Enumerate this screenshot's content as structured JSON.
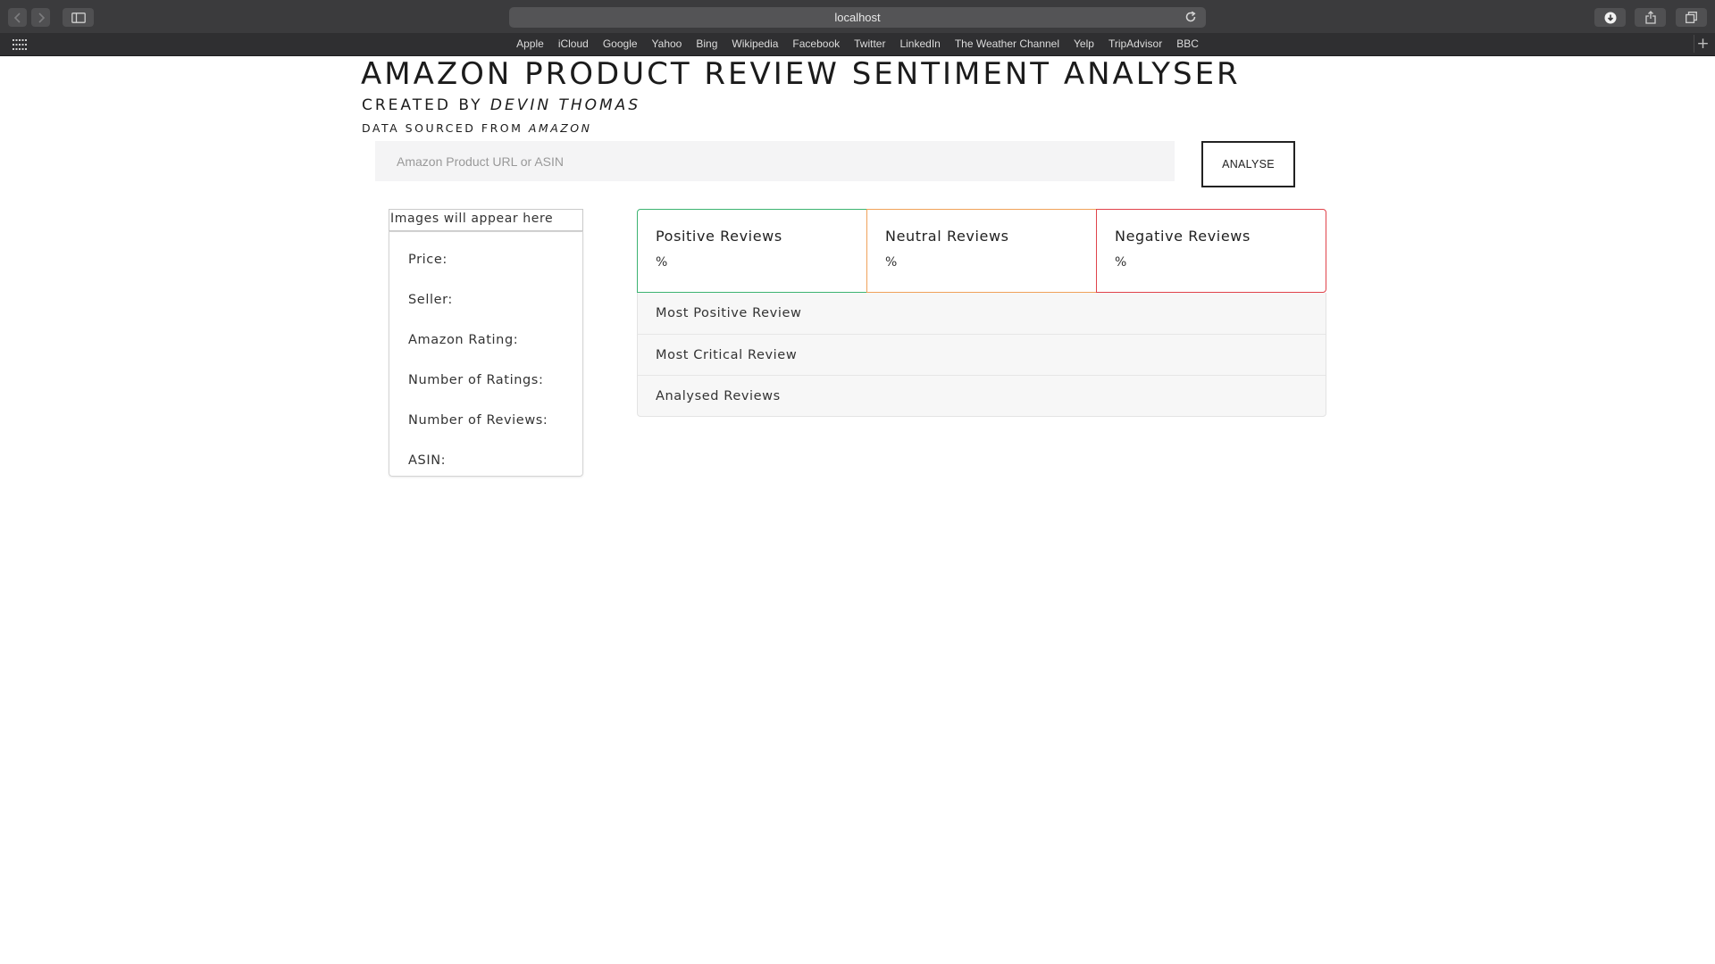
{
  "browser": {
    "url": "localhost",
    "favorites": [
      "Apple",
      "iCloud",
      "Google",
      "Yahoo",
      "Bing",
      "Wikipedia",
      "Facebook",
      "Twitter",
      "LinkedIn",
      "The Weather Channel",
      "Yelp",
      "TripAdvisor",
      "BBC"
    ]
  },
  "header": {
    "title": "AMAZON PRODUCT REVIEW SENTIMENT ANALYSER",
    "created_by_prefix": "CREATED BY ",
    "author": "DEVIN THOMAS",
    "source_prefix": "DATA SOURCED FROM ",
    "source": "AMAZON"
  },
  "search": {
    "placeholder": "Amazon Product URL or ASIN",
    "button_label": "ANALYSE"
  },
  "product": {
    "image_placeholder": "Images will appear here",
    "fields": [
      "Price:",
      "Seller:",
      "Amazon Rating:",
      "Number of Ratings:",
      "Number of Reviews:",
      "ASIN:"
    ]
  },
  "stats": {
    "positive": {
      "label": "Positive Reviews",
      "value": "%",
      "color": "#3cb371"
    },
    "neutral": {
      "label": "Neutral Reviews",
      "value": "%",
      "color": "#f0a25a"
    },
    "negative": {
      "label": "Negative Reviews",
      "value": "%",
      "color": "#e0434b"
    }
  },
  "sections": [
    "Most Positive Review",
    "Most Critical Review",
    "Analysed Reviews"
  ]
}
